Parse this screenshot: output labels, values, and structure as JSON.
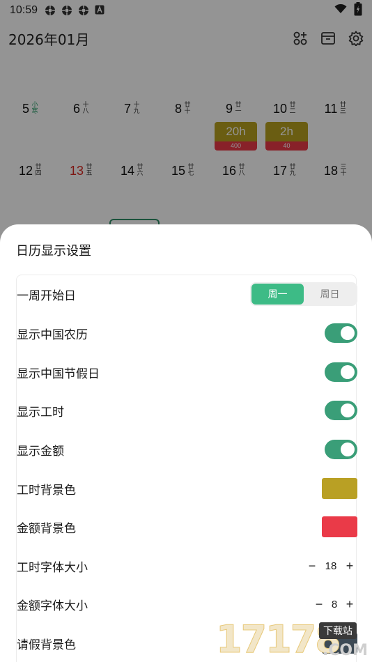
{
  "status_bar": {
    "time": "10:59",
    "notifications": [
      "app-notification-icon",
      "app-notification-icon",
      "app-notification-icon",
      "font-a-icon"
    ],
    "wifi_icon": "wifi-icon",
    "battery_icon": "battery-charging-icon"
  },
  "header": {
    "title": "2026年01月",
    "actions": [
      "grid-add-icon",
      "archive-icon",
      "settings-gear-icon"
    ]
  },
  "calendar": {
    "weeks": [
      {
        "days": [
          {
            "num": "5",
            "lunar": "小寒",
            "lunar_color": "green",
            "red": false
          },
          {
            "num": "6",
            "lunar": "十八",
            "red": false
          },
          {
            "num": "7",
            "lunar": "十九",
            "red": false
          },
          {
            "num": "8",
            "lunar": "廿十",
            "red": false
          },
          {
            "num": "9",
            "lunar": "廿一",
            "red": false,
            "hours": "20h",
            "amount": "400"
          },
          {
            "num": "10",
            "lunar": "廿二",
            "red": false,
            "hours": "2h",
            "amount": "40"
          },
          {
            "num": "11",
            "lunar": "廿三",
            "red": false
          }
        ]
      },
      {
        "days": [
          {
            "num": "12",
            "lunar": "廿四",
            "red": false
          },
          {
            "num": "13",
            "lunar": "廿五",
            "red": true
          },
          {
            "num": "14",
            "lunar": "廿六",
            "red": false
          },
          {
            "num": "15",
            "lunar": "廿七",
            "red": false
          },
          {
            "num": "16",
            "lunar": "廿八",
            "red": false
          },
          {
            "num": "17",
            "lunar": "廿九",
            "red": false
          },
          {
            "num": "18",
            "lunar": "三十",
            "red": false
          }
        ]
      }
    ]
  },
  "sheet": {
    "title": "日历显示设置",
    "week_start": {
      "label": "一周开始日",
      "options": [
        "周一",
        "周日"
      ],
      "selected": "周一"
    },
    "toggles": [
      {
        "label": "显示中国农历",
        "on": true
      },
      {
        "label": "显示中国节假日",
        "on": true
      },
      {
        "label": "显示工时",
        "on": true
      },
      {
        "label": "显示金额",
        "on": true
      }
    ],
    "colors": [
      {
        "label": "工时背景色",
        "color": "#B9A024"
      },
      {
        "label": "金额背景色",
        "color": "#EA3A48"
      }
    ],
    "steppers": [
      {
        "label": "工时字体大小",
        "value": "18",
        "minus": "−",
        "plus": "+"
      },
      {
        "label": "金额字体大小",
        "value": "8",
        "minus": "−",
        "plus": "+"
      }
    ],
    "leave": {
      "label": "请假背景色",
      "color": "#3D4A55"
    }
  },
  "accent_colors": {
    "primary": "#3DBB86",
    "toggle": "#3A9E78"
  },
  "watermark": {
    "digits": "17178",
    "tag": "下载站",
    "suffix": ".COM"
  }
}
